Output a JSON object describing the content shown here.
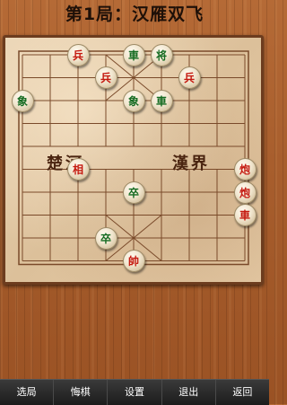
{
  "title": "第1局：汉雁双飞",
  "board": {
    "river_left": "楚河",
    "river_right": "漢界"
  },
  "pieces": [
    {
      "label": "兵",
      "side": "red",
      "col": 2,
      "row": 0
    },
    {
      "label": "車",
      "side": "black",
      "col": 4,
      "row": 0
    },
    {
      "label": "将",
      "side": "black",
      "col": 5,
      "row": 0
    },
    {
      "label": "兵",
      "side": "red",
      "col": 3,
      "row": 1
    },
    {
      "label": "兵",
      "side": "red",
      "col": 6,
      "row": 1
    },
    {
      "label": "象",
      "side": "black",
      "col": 0,
      "row": 2
    },
    {
      "label": "象",
      "side": "black",
      "col": 4,
      "row": 2
    },
    {
      "label": "車",
      "side": "black",
      "col": 5,
      "row": 2
    },
    {
      "label": "相",
      "side": "red",
      "col": 2,
      "row": 5
    },
    {
      "label": "炮",
      "side": "red",
      "col": 8,
      "row": 5
    },
    {
      "label": "卒",
      "side": "black",
      "col": 4,
      "row": 6
    },
    {
      "label": "炮",
      "side": "red",
      "col": 8,
      "row": 6
    },
    {
      "label": "車",
      "side": "red",
      "col": 8,
      "row": 7
    },
    {
      "label": "卒",
      "side": "black",
      "col": 3,
      "row": 8
    },
    {
      "label": "帥",
      "side": "red",
      "col": 4,
      "row": 9
    }
  ],
  "toolbar": {
    "select": "选局",
    "undo": "悔棋",
    "settings": "设置",
    "exit": "退出",
    "back": "返回"
  },
  "colors": {
    "red_piece_text": "#c4190f",
    "black_piece_text": "#156b21",
    "grid_line": "#7a4a2a"
  }
}
